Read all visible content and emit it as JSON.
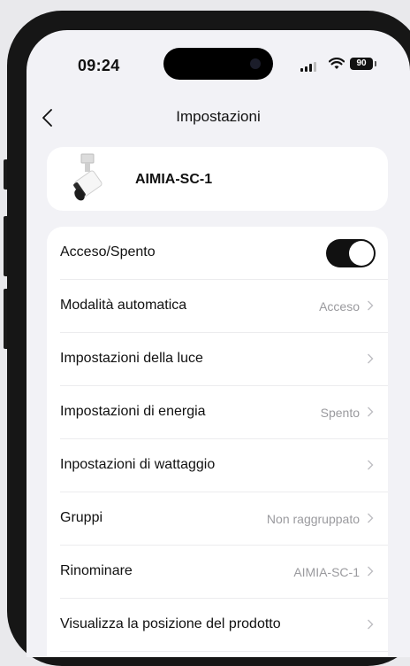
{
  "status_bar": {
    "time": "09:24",
    "battery": "90"
  },
  "nav": {
    "title": "Impostazioni"
  },
  "device": {
    "name": "AIMIA-SC-1"
  },
  "settings": {
    "power_label": "Acceso/Spento",
    "power_on": true,
    "rows": [
      {
        "label": "Modalità automatica",
        "value": "Acceso"
      },
      {
        "label": "Impostazioni della luce",
        "value": ""
      },
      {
        "label": "Impostazioni di energia",
        "value": "Spento"
      },
      {
        "label": "Inpostazioni di wattaggio",
        "value": ""
      },
      {
        "label": "Gruppi",
        "value": "Non raggruppato"
      },
      {
        "label": "Rinominare",
        "value": "AIMIA-SC-1"
      },
      {
        "label": "Visualizza la posizione del prodotto",
        "value": ""
      }
    ]
  }
}
